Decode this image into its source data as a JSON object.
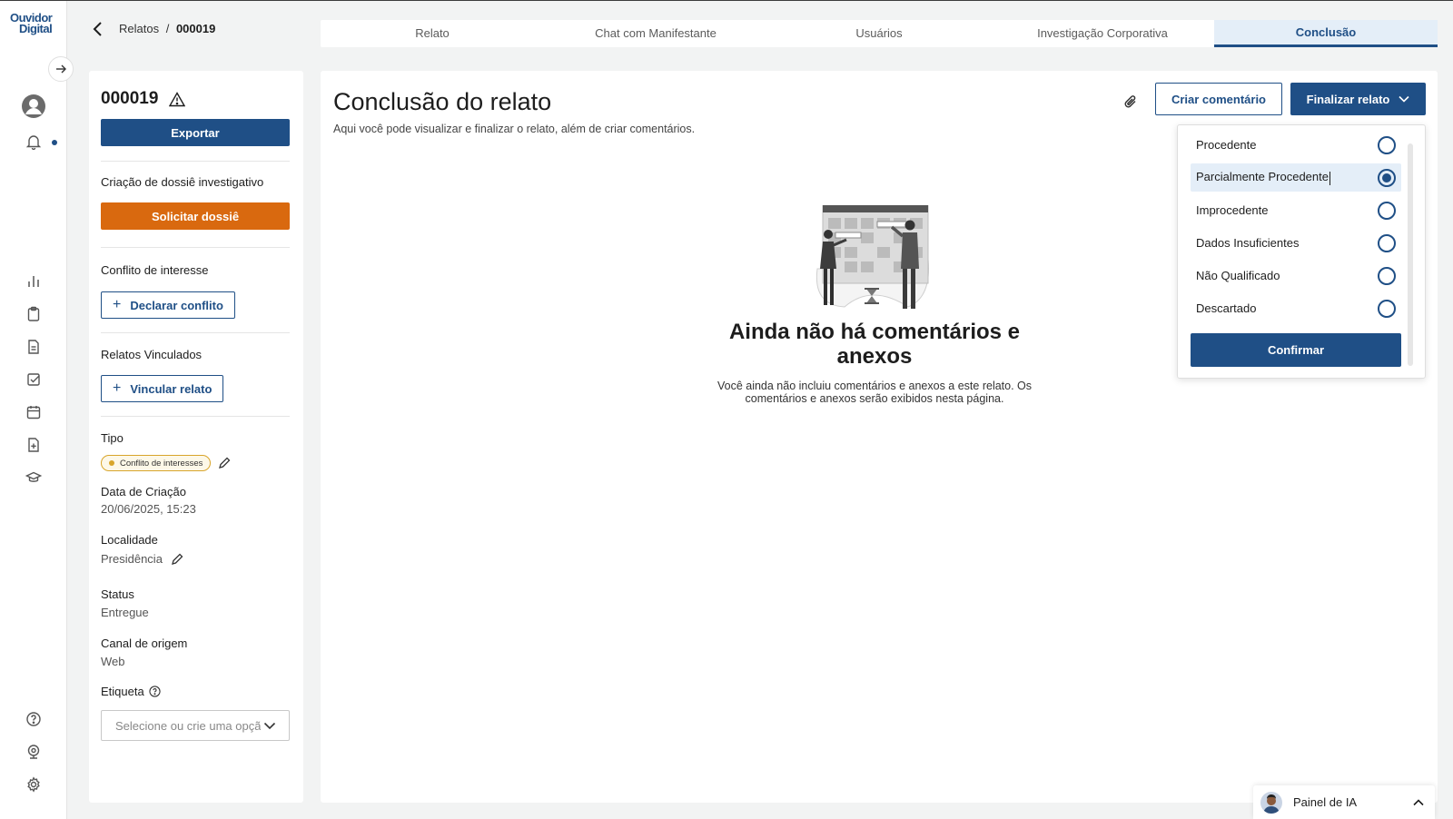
{
  "app": {
    "logo_line1": "Ouvidor",
    "logo_line2": "Digital"
  },
  "breadcrumb": {
    "parent": "Relatos",
    "separator": "/",
    "current": "000019"
  },
  "tabs": [
    {
      "label": "Relato",
      "active": false
    },
    {
      "label": "Chat com Manifestante",
      "active": false
    },
    {
      "label": "Usuários",
      "active": false
    },
    {
      "label": "Investigação Corporativa",
      "active": false
    },
    {
      "label": "Conclusão",
      "active": true
    }
  ],
  "sidebar": {
    "report_id": "000019",
    "export_label": "Exportar",
    "dossier_label": "Criação de dossiê investigativo",
    "dossier_button": "Solicitar dossiê",
    "conflict_label": "Conflito de interesse",
    "conflict_button": "Declarar conflito",
    "linked_label": "Relatos Vinculados",
    "linked_button": "Vincular relato",
    "type_label": "Tipo",
    "type_value": "Conflito de interesses",
    "created_label": "Data de Criação",
    "created_value": "20/06/2025, 15:23",
    "location_label": "Localidade",
    "location_value": "Presidência",
    "status_label": "Status",
    "status_value": "Entregue",
    "channel_label": "Canal de origem",
    "channel_value": "Web",
    "tag_label": "Etiqueta",
    "tag_placeholder": "Selecione ou crie uma opção"
  },
  "main": {
    "title": "Conclusão do relato",
    "subtitle": "Aqui você pode visualizar e finalizar o relato, além de criar comentários.",
    "create_comment": "Criar comentário",
    "finalize": "Finalizar relato",
    "empty_title": "Ainda não há comentários e anexos",
    "empty_desc": "Você ainda não incluiu comentários e anexos a este relato. Os comentários e anexos serão exibidos nesta página."
  },
  "finalize_menu": {
    "options": [
      {
        "label": "Procedente",
        "selected": false
      },
      {
        "label": "Parcialmente Procedente",
        "selected": true
      },
      {
        "label": "Improcedente",
        "selected": false
      },
      {
        "label": "Dados Insuficientes",
        "selected": false
      },
      {
        "label": "Não Qualificado",
        "selected": false
      },
      {
        "label": "Descartado",
        "selected": false
      }
    ],
    "confirm": "Confirmar"
  },
  "ai_panel": {
    "label": "Painel de IA"
  },
  "colors": {
    "primary": "#1f4f86",
    "accent": "#d9690f",
    "chip_border": "#d8a52b"
  }
}
